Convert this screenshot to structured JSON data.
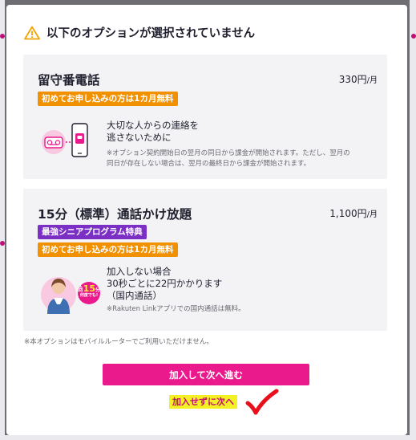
{
  "modal": {
    "title": "以下のオプションが選択されていません",
    "footnote": "※本オプションはモバイルルーターでご利用いただけません。",
    "primary_button": "加入して次へ進む",
    "skip_link": "加入せずに次へ"
  },
  "options": [
    {
      "name": "留守番電話",
      "price": "330円",
      "price_unit": "/月",
      "tags": [
        "初めてお申し込みの方は1カ月無料"
      ],
      "description_lines": [
        "大切な人からの連絡を",
        "逃さないために"
      ],
      "note_lines": [
        "※オプション契約開始日の翌月の同日から課金が開始されます。ただし、翌月の",
        "同日が存在しない場合は、翌月の最終日から課金が開始されます。"
      ],
      "icon": "voicemail-phone-icon"
    },
    {
      "name": "15分（標準）通話かけ放題",
      "price": "1,100円",
      "price_unit": "/月",
      "tags": [
        "最強シニアプログラム特典",
        "初めてお申し込みの方は1カ月無料"
      ],
      "description_lines": [
        "加入しない場合",
        "30秒ごとに22円かかります",
        "（国内通話）"
      ],
      "note_lines": [
        "※Rakuten Linkアプリでの国内通話は無料。"
      ],
      "badge": {
        "line1": "1回",
        "number": "15",
        "unit": "分",
        "line3": "何度でも!"
      },
      "icon": "senior-caller-icon"
    }
  ],
  "icons": {
    "warning": "warning-triangle-icon",
    "checkmark": "red-checkmark-annotation"
  },
  "colors": {
    "accent_pink": "#ea1a8c",
    "tag_orange": "#f29100",
    "tag_purple": "#7b2fc4",
    "highlight_yellow": "#f3f026",
    "warning_orange": "#f0a500",
    "annotation_red": "#e8101c"
  }
}
